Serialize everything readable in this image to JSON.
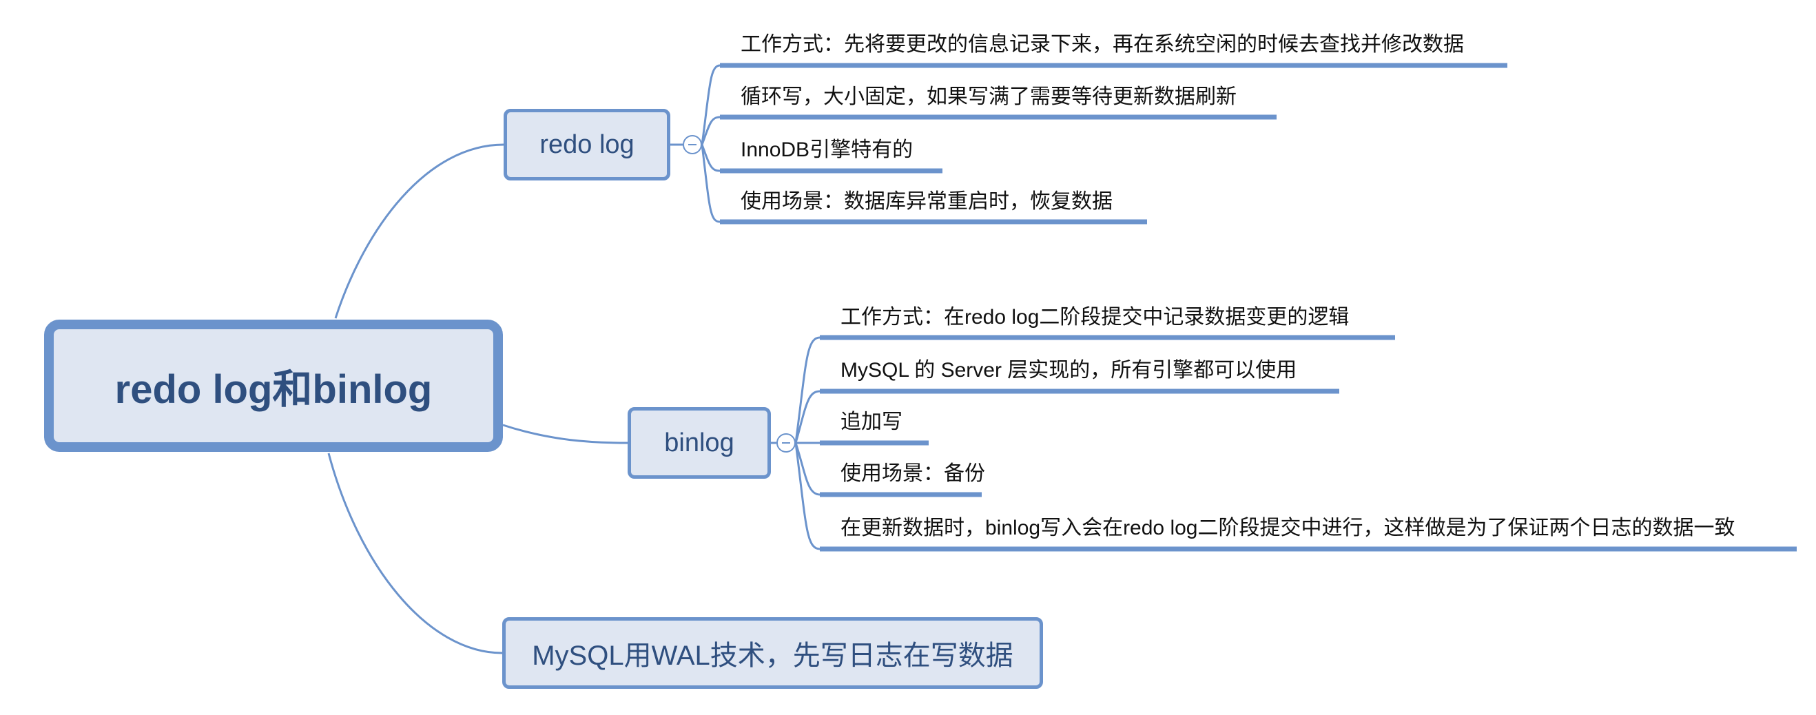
{
  "root": {
    "label": "redo log和binlog"
  },
  "branches": {
    "redo": {
      "label": "redo log",
      "items": [
        "工作方式：先将要更改的信息记录下来，再在系统空闲的时候去查找并修改数据",
        "循环写，大小固定，如果写满了需要等待更新数据刷新",
        "InnoDB引擎特有的",
        "使用场景：数据库异常重启时，恢复数据"
      ]
    },
    "binlog": {
      "label": "binlog",
      "items": [
        "工作方式：在redo log二阶段提交中记录数据变更的逻辑",
        "MySQL 的 Server 层实现的，所有引擎都可以使用",
        "追加写",
        "使用场景：备份",
        "在更新数据时，binlog写入会在redo log二阶段提交中进行，这样做是为了保证两个日志的数据一致"
      ]
    },
    "wal": {
      "label": "MySQL用WAL技术，先写日志在写数据"
    }
  },
  "colors": {
    "line": "#6b93cc",
    "node_fill": "#dfe6f2",
    "node_text": "#2f4f7f"
  }
}
